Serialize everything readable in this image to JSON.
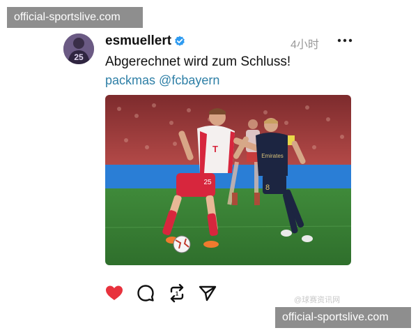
{
  "watermark": {
    "top": "official-sportslive.com",
    "bottom": "official-sportslive.com",
    "weibo": "@球赛资讯网"
  },
  "post": {
    "avatar_number": "25",
    "username": "esmuellert",
    "time": "4小时",
    "caption": "Abgerechnet wird zum Schluss!",
    "mentions": [
      "packmas",
      "@fcbayern"
    ],
    "jersey_numbers": {
      "left_player": "25",
      "right_player": "8"
    },
    "sponsor_text": "Emirates",
    "liked": true
  },
  "colors": {
    "link": "#2e7fa6",
    "like": "#e8323d",
    "verified": "#2f9bf0",
    "pitch": "#3f8a3a",
    "crowd": "#a53a3a",
    "ad_board": "#2a7ed6"
  },
  "icons": [
    "verified-badge-icon",
    "more-options-icon",
    "heart-icon",
    "comment-icon",
    "repost-icon",
    "share-icon"
  ]
}
